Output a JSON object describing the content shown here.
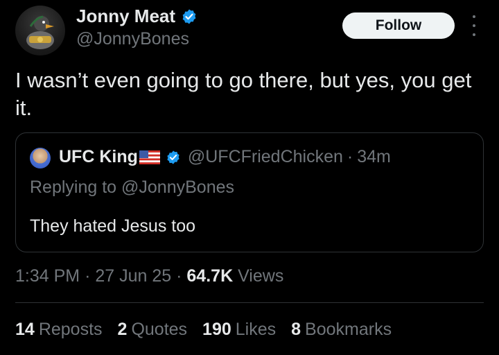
{
  "author": {
    "display_name": "Jonny Meat",
    "handle": "@JonnyBones",
    "avatar_icon": "duck-avatar-icon",
    "verified_icon": "verified-badge-icon"
  },
  "follow_label": "Follow",
  "tweet_text": "I wasn’t even going to go there, but yes, you get it.",
  "quoted": {
    "display_name": "UFC King",
    "flag_icon": "us-flag-icon",
    "handle": "@UFCFriedChicken",
    "separator": "·",
    "time": "34m",
    "replying_to": "Replying to @JonnyBones",
    "text": "They hated Jesus too"
  },
  "meta": {
    "time": "1:34 PM",
    "sep1": "·",
    "date": "27 Jun 25",
    "sep2": "·",
    "views_count": "64.7K",
    "views_label": "Views"
  },
  "stats": [
    {
      "count": "14",
      "label": "Reposts"
    },
    {
      "count": "2",
      "label": "Quotes"
    },
    {
      "count": "190",
      "label": "Likes"
    },
    {
      "count": "8",
      "label": "Bookmarks"
    }
  ],
  "colors": {
    "background": "#000000",
    "text_primary": "#e7e9ea",
    "text_secondary": "#71767b",
    "border": "#2f3336",
    "verified_blue": "#1d9bf0",
    "button_bg": "#eff3f4"
  }
}
